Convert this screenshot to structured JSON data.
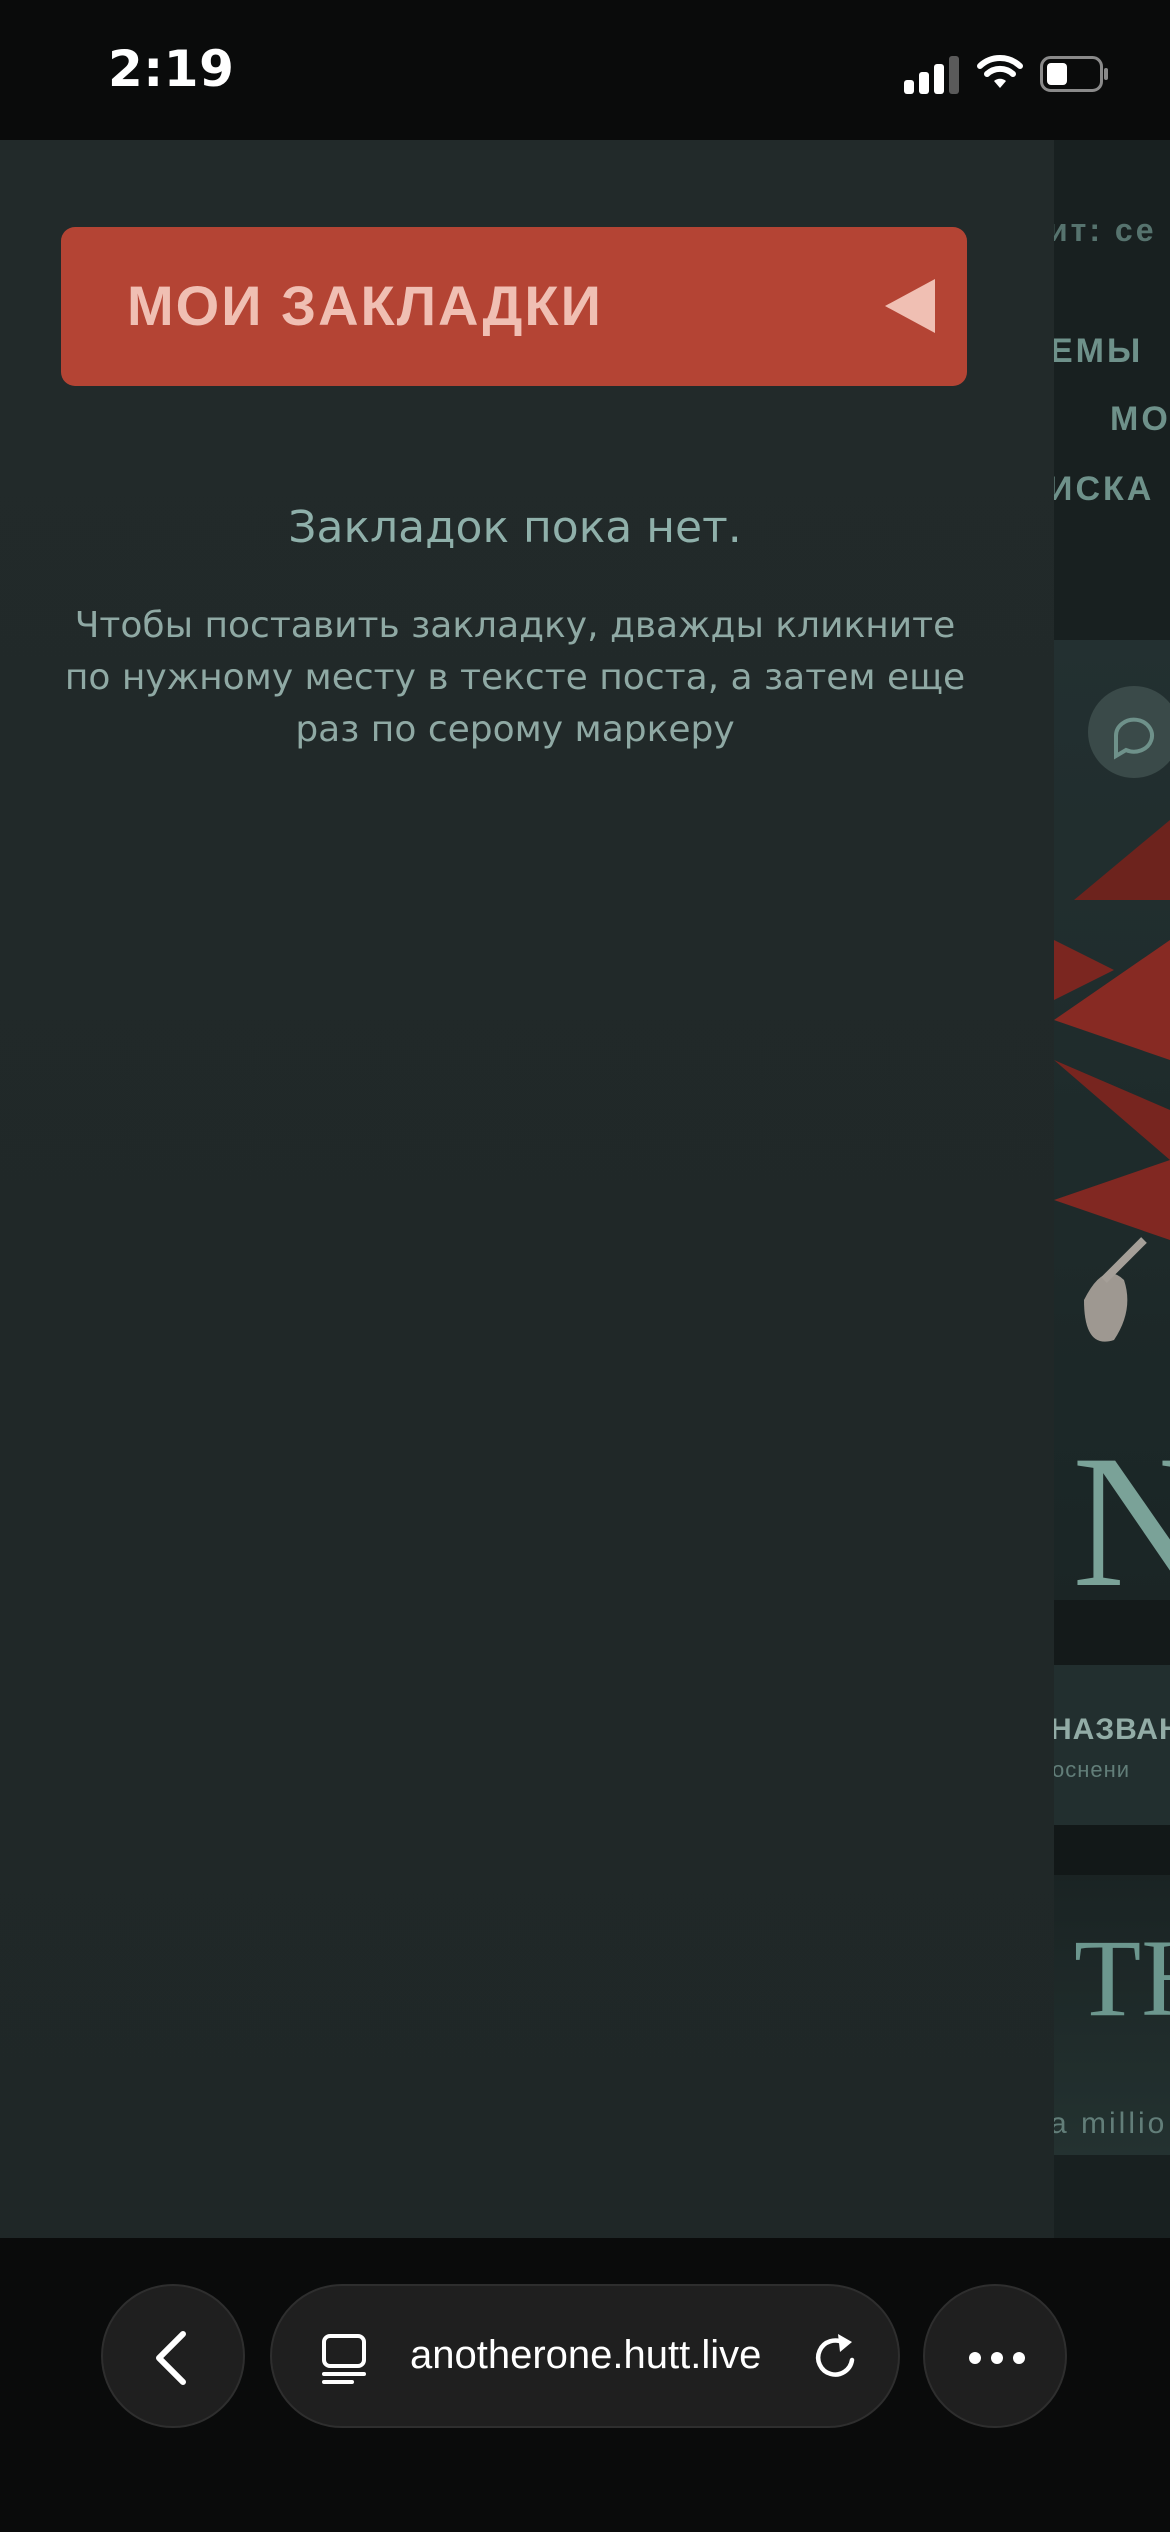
{
  "status_bar": {
    "time": "2:19"
  },
  "background_page": {
    "line1": "ит: се",
    "line2": "ЕМЫ",
    "line3": "МО",
    "line4": "ИСКА",
    "caption_title": "НАЗВАН",
    "caption_sub": "оснени",
    "big_letters": "N",
    "heading_letters": "ТН",
    "footer_text": "a millio"
  },
  "bookmarks": {
    "title": "МОИ ЗАКЛАДКИ",
    "empty_title": "Закладок пока нет.",
    "empty_hint": "Чтобы поставить закладку, дважды кликните по нужному месту в тексте поста, а затем еще раз по серому маркеру"
  },
  "browser": {
    "url": "anotherone.hutt.live"
  },
  "colors": {
    "accent": "#b44434",
    "accent_text": "#f0bfb3",
    "panel": "#222a2a",
    "muted_text": "#8fb0aa"
  }
}
